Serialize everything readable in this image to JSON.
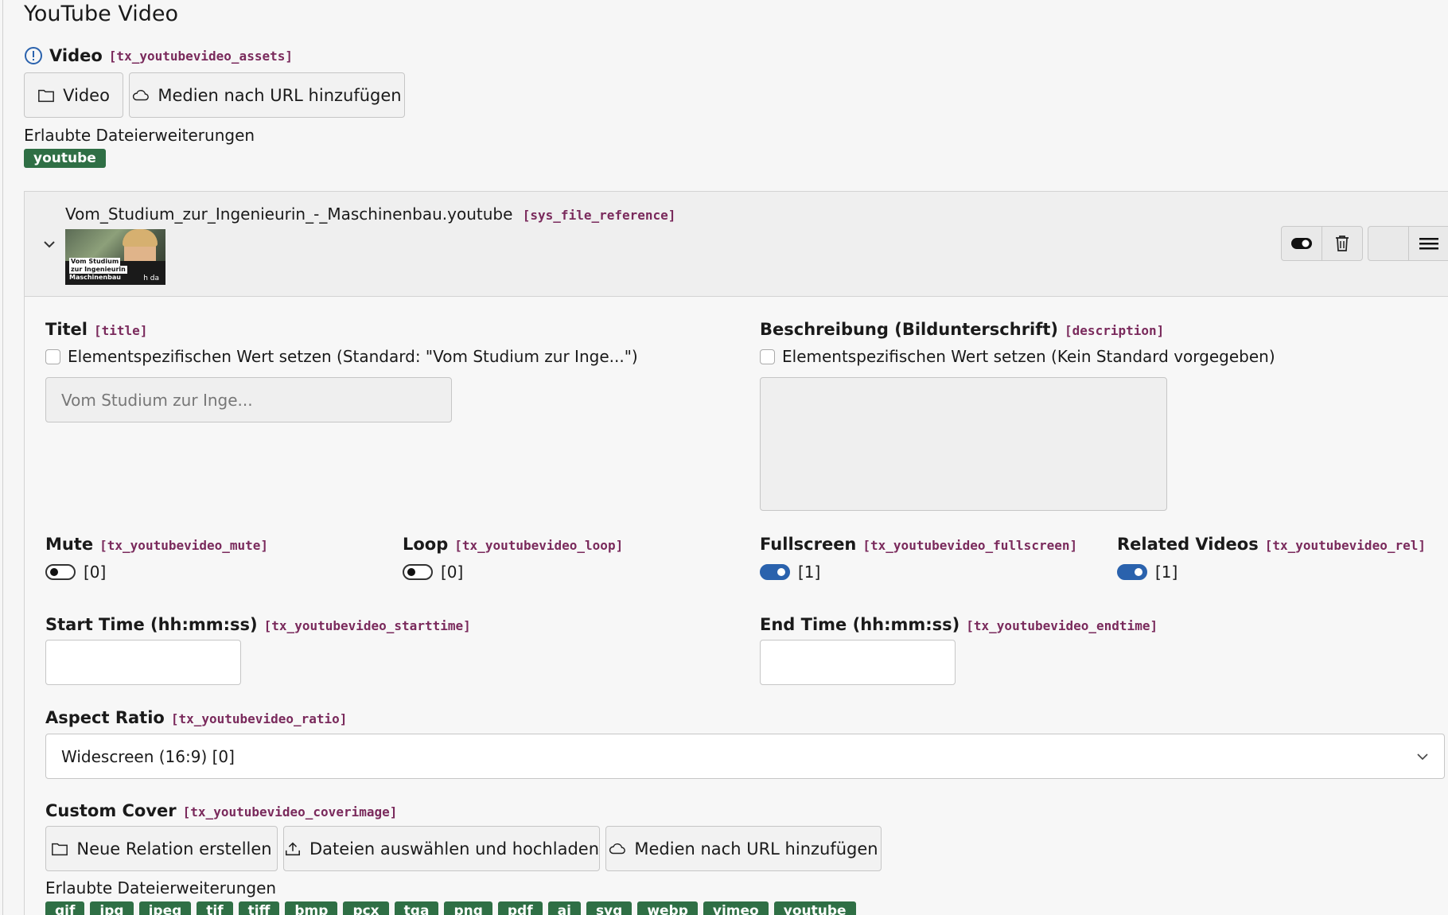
{
  "page_title": "YouTube Video",
  "video_field": {
    "label": "Video",
    "code": "[tx_youtubevideo_assets]",
    "btn_video": "Video",
    "btn_url": "Medien nach URL hinzufügen",
    "allowed_label": "Erlaubte Dateierweiterungen",
    "allowed": [
      "youtube"
    ]
  },
  "reference": {
    "filename": "Vom_Studium_zur_Ingenieurin_-_Maschinenbau.youtube",
    "code": "[sys_file_reference]",
    "thumb_lines": [
      "Vom Studium",
      "zur Ingenieurin",
      "Maschinenbau"
    ],
    "thumb_brand": "h da"
  },
  "title_field": {
    "label": "Titel",
    "code": "[title]",
    "checkbox_label": "Elementspezifischen Wert setzen (Standard: \"Vom Studium zur Inge...\")",
    "placeholder": "Vom Studium zur Inge..."
  },
  "description_field": {
    "label": "Beschreibung (Bildunterschrift)",
    "code": "[description]",
    "checkbox_label": "Elementspezifischen Wert setzen (Kein Standard vorgegeben)"
  },
  "toggles": [
    {
      "label": "Mute",
      "code": "[tx_youtubevideo_mute]",
      "value": "[0]",
      "on": false
    },
    {
      "label": "Loop",
      "code": "[tx_youtubevideo_loop]",
      "value": "[0]",
      "on": false
    },
    {
      "label": "Fullscreen",
      "code": "[tx_youtubevideo_fullscreen]",
      "value": "[1]",
      "on": true
    },
    {
      "label": "Related Videos",
      "code": "[tx_youtubevideo_rel]",
      "value": "[1]",
      "on": true
    }
  ],
  "start_time": {
    "label": "Start Time (hh:mm:ss)",
    "code": "[tx_youtubevideo_starttime]",
    "value": ""
  },
  "end_time": {
    "label": "End Time (hh:mm:ss)",
    "code": "[tx_youtubevideo_endtime]",
    "value": ""
  },
  "aspect_ratio": {
    "label": "Aspect Ratio",
    "code": "[tx_youtubevideo_ratio]",
    "selected": "Widescreen (16:9) [0]"
  },
  "cover": {
    "label": "Custom Cover",
    "code": "[tx_youtubevideo_coverimage]",
    "btn_relation": "Neue Relation erstellen",
    "btn_upload": "Dateien auswählen und hochladen",
    "btn_url": "Medien nach URL hinzufügen",
    "allowed_label": "Erlaubte Dateierweiterungen",
    "allowed": [
      "gif",
      "jpg",
      "jpeg",
      "tif",
      "tiff",
      "bmp",
      "pcx",
      "tga",
      "png",
      "pdf",
      "ai",
      "svg",
      "webp",
      "vimeo",
      "youtube"
    ]
  },
  "colors": {
    "accent": "#2a62ad",
    "badge": "#2f6f45",
    "code": "#7a2a5c"
  }
}
